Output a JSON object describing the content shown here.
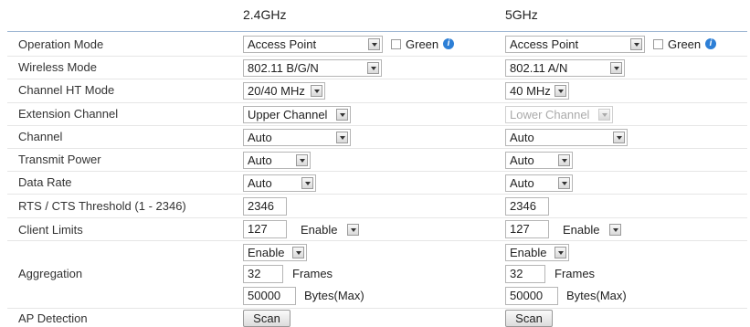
{
  "columns": {
    "a": "2.4GHz",
    "b": "5GHz"
  },
  "labels": {
    "operation_mode": "Operation Mode",
    "wireless_mode": "Wireless Mode",
    "channel_ht_mode": "Channel HT Mode",
    "extension_channel": "Extension Channel",
    "channel": "Channel",
    "transmit_power": "Transmit Power",
    "data_rate": "Data Rate",
    "rts_cts": "RTS / CTS Threshold (1 - 2346)",
    "client_limits": "Client Limits",
    "aggregation": "Aggregation",
    "ap_detection": "AP Detection"
  },
  "green_label": "Green",
  "info_glyph": "i",
  "frames_label": "Frames",
  "bytes_label": "Bytes(Max)",
  "scan_label": "Scan",
  "band_a": {
    "operation_mode": "Access Point",
    "green_checked": false,
    "wireless_mode": "802.11 B/G/N",
    "channel_ht_mode": "20/40 MHz",
    "extension_channel": "Upper Channel",
    "channel": "Auto",
    "transmit_power": "Auto",
    "data_rate": "Auto",
    "rts_cts": "2346",
    "client_limits": "127",
    "client_limits_state": "Enable",
    "aggregation_state": "Enable",
    "aggregation_frames": "32",
    "aggregation_bytes": "50000"
  },
  "band_b": {
    "operation_mode": "Access Point",
    "green_checked": false,
    "wireless_mode": "802.11 A/N",
    "channel_ht_mode": "40 MHz",
    "extension_channel": "Lower Channel",
    "channel": "Auto",
    "transmit_power": "Auto",
    "data_rate": "Auto",
    "rts_cts": "2346",
    "client_limits": "127",
    "client_limits_state": "Enable",
    "aggregation_state": "Enable",
    "aggregation_frames": "32",
    "aggregation_bytes": "50000"
  },
  "colors": {
    "accent": "#2d7fd6",
    "rule": "#9fb7d3"
  }
}
